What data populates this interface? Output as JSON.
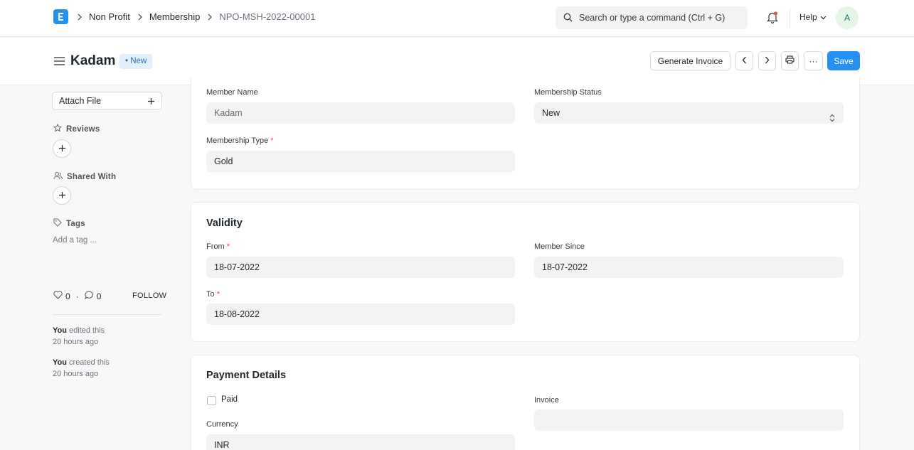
{
  "navbar": {
    "breadcrumbs": [
      "Non Profit",
      "Membership",
      "NPO-MSH-2022-00001"
    ],
    "search_placeholder": "Search or type a command (Ctrl + G)",
    "help_label": "Help",
    "avatar_initial": "A"
  },
  "page": {
    "title": "Kadam",
    "status": "• New",
    "buttons": {
      "generate_invoice": "Generate Invoice",
      "more": "···",
      "save": "Save"
    }
  },
  "sidebar": {
    "attach_file": "Attach File",
    "reviews": "Reviews",
    "shared_with": "Shared With",
    "tags": "Tags",
    "add_tag": "Add a tag ...",
    "likes": "0",
    "dot": "·",
    "comments": "0",
    "follow": "FOLLOW",
    "activity": [
      {
        "user": "You",
        "action": " edited this",
        "time": "20 hours ago"
      },
      {
        "user": "You",
        "action": " created this",
        "time": "20 hours ago"
      }
    ]
  },
  "form": {
    "member_name_label": "Member Name",
    "member_name": "Kadam",
    "membership_status_label": "Membership Status",
    "membership_status": "New",
    "membership_type_label": "Membership Type",
    "membership_type": "Gold",
    "required_mark": "*",
    "validity": {
      "title": "Validity",
      "from_label": "From",
      "from": "18-07-2022",
      "member_since_label": "Member Since",
      "member_since": "18-07-2022",
      "to_label": "To",
      "to": "18-08-2022"
    },
    "payment": {
      "title": "Payment Details",
      "paid_label": "Paid",
      "invoice_label": "Invoice",
      "invoice": "",
      "currency_label": "Currency",
      "currency": "INR"
    }
  },
  "colors": {
    "primary": "#2490ef",
    "required": "#e24c4c",
    "indicator_bg": "#e2f0fd"
  }
}
